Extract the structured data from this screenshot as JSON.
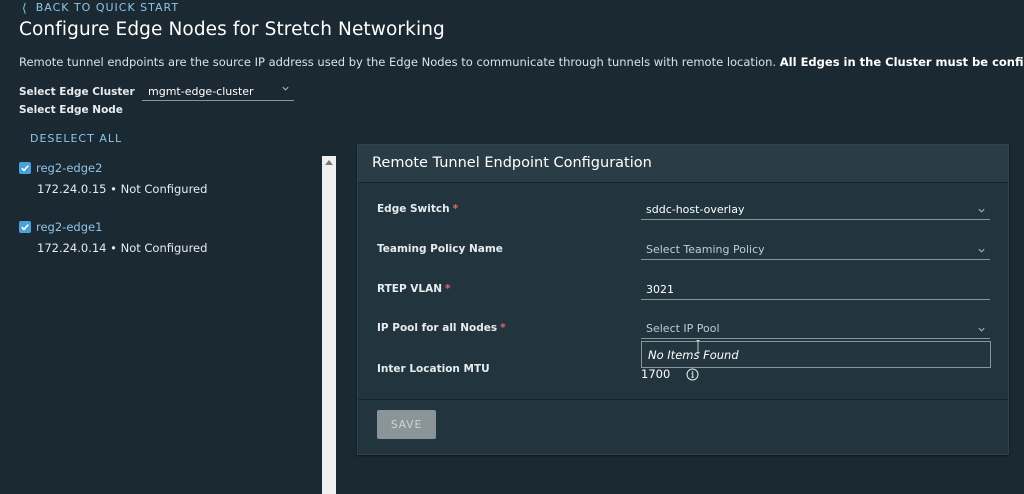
{
  "nav": {
    "back_label": "BACK TO QUICK START"
  },
  "page": {
    "title": "Configure Edge Nodes for Stretch Networking",
    "description": "Remote tunnel endpoints are the source IP address used by the Edge Nodes to communicate through tunnels with remote location. ",
    "description_bold": "All Edges in the Cluster must be configured."
  },
  "edge_cluster": {
    "label": "Select Edge Cluster",
    "value": "mgmt-edge-cluster"
  },
  "edge_node": {
    "label": "Select Edge Node",
    "deselect_all_label": "DESELECT ALL",
    "nodes": [
      {
        "name": "reg2-edge2",
        "status": "172.24.0.15 • Not Configured",
        "checked": true
      },
      {
        "name": "reg2-edge1",
        "status": "172.24.0.14 • Not Configured",
        "checked": true
      }
    ]
  },
  "rtep_card": {
    "title": "Remote Tunnel Endpoint Configuration",
    "fields": {
      "edge_switch": {
        "label": "Edge Switch",
        "required_mark": "*",
        "value": "sddc-host-overlay"
      },
      "teaming_policy": {
        "label": "Teaming Policy Name",
        "placeholder": "Select Teaming Policy"
      },
      "rtep_vlan": {
        "label": "RTEP VLAN",
        "required_mark": "*",
        "value": "3021"
      },
      "ip_pool": {
        "label": "IP Pool for all Nodes",
        "required_mark": "*",
        "placeholder": "Select IP Pool",
        "dropdown_message": "No Items Found"
      },
      "mtu": {
        "label": "Inter Location MTU",
        "value": "1700"
      }
    },
    "save_label": "SAVE"
  },
  "colors": {
    "background": "#1b2a32",
    "card": "#22343d",
    "link": "#8fc4e8",
    "checkbox": "#4aa0d8",
    "required": "#e26a6a",
    "button_disabled": "#8b9499"
  },
  "icons": {
    "back": "chevron-left-icon",
    "dropdown": "chevron-down-icon",
    "checkbox": "checkmark-icon",
    "info": "info-circle-icon"
  }
}
